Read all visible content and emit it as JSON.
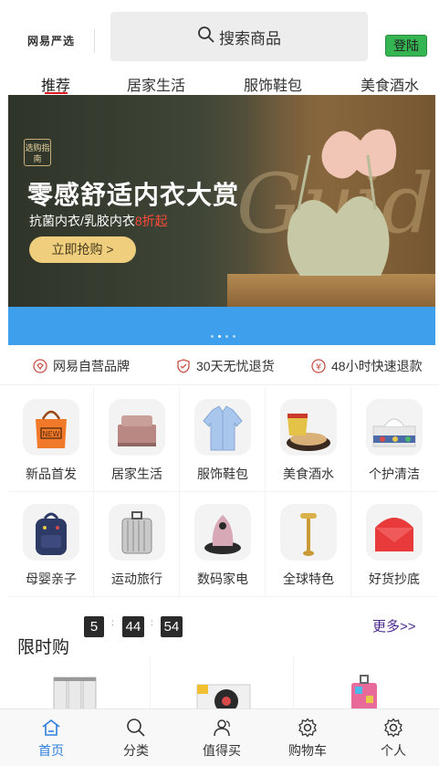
{
  "header": {
    "logo_text": "网易严选",
    "search_placeholder": "搜索商品",
    "login_label": "登陆"
  },
  "tabs": [
    {
      "label": "推荐",
      "active": true
    },
    {
      "label": "居家生活",
      "active": false
    },
    {
      "label": "服饰鞋包",
      "active": false
    },
    {
      "label": "美食酒水",
      "active": false
    }
  ],
  "banner": {
    "badge": "选购指南",
    "title": "零感舒适内衣大赏",
    "subtitle": "抗菌内衣/乳胶内衣",
    "subtitle_highlight": "8折起",
    "button_label": "立即抢购 >",
    "watermark": "Guide",
    "dots_count": 4,
    "active_dot": 1
  },
  "promises": [
    {
      "icon": "brand-icon",
      "label": "网易自营品牌"
    },
    {
      "icon": "shield-icon",
      "label": "30天无忧退货"
    },
    {
      "icon": "yen-icon",
      "label": "48小时快速退款"
    }
  ],
  "categories": [
    {
      "label": "新品首发",
      "icon": "new-bag-icon"
    },
    {
      "label": "居家生活",
      "icon": "bed-icon"
    },
    {
      "label": "服饰鞋包",
      "icon": "shirt-icon"
    },
    {
      "label": "美食酒水",
      "icon": "noodle-icon"
    },
    {
      "label": "个护清洁",
      "icon": "tissue-icon"
    },
    {
      "label": "母婴亲子",
      "icon": "backpack-icon"
    },
    {
      "label": "运动旅行",
      "icon": "suitcase-icon"
    },
    {
      "label": "数码家电",
      "icon": "vacuum-icon"
    },
    {
      "label": "全球特色",
      "icon": "roller-icon"
    },
    {
      "label": "好货抄底",
      "icon": "envelope-icon"
    }
  ],
  "flash_sale": {
    "title": "限时购",
    "hours": "5",
    "minutes": "44",
    "seconds": "54",
    "separator": ":",
    "more_label": "更多>>"
  },
  "tabbar": [
    {
      "label": "首页",
      "icon": "home-icon",
      "active": true
    },
    {
      "label": "分类",
      "icon": "search-icon",
      "active": false
    },
    {
      "label": "值得买",
      "icon": "user-group-icon",
      "active": false
    },
    {
      "label": "购物车",
      "icon": "gear-icon",
      "active": false
    },
    {
      "label": "个人",
      "icon": "gear-icon",
      "active": false
    }
  ],
  "colors": {
    "accent_red": "#dd1a21",
    "login_green": "#34b552",
    "tab_active_blue": "#2f7fdc",
    "banner_blue": "#3ea0ec"
  }
}
